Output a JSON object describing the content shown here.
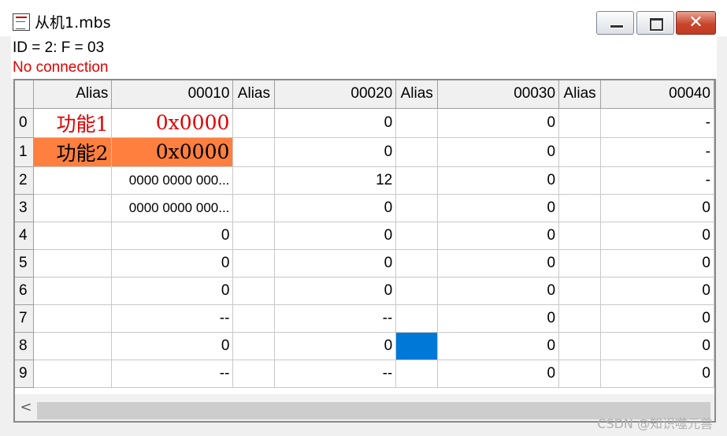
{
  "window": {
    "title": "从机1.mbs",
    "close_glyph": "✕"
  },
  "info": {
    "line1": "ID = 2: F = 03",
    "line2": "No connection"
  },
  "grid": {
    "headers": [
      "Alias",
      "00010",
      "Alias",
      "00020",
      "Alias",
      "00030",
      "Alias",
      "00040"
    ],
    "rows": [
      {
        "row": "0",
        "a1": "功能1",
        "c1": "0x0000",
        "a2": "",
        "c2": "0",
        "a3": "",
        "c3": "0",
        "a4": "",
        "c4": "-"
      },
      {
        "row": "1",
        "a1": "功能2",
        "c1": "0x0000",
        "a2": "",
        "c2": "0",
        "a3": "",
        "c3": "0",
        "a4": "",
        "c4": "-"
      },
      {
        "row": "2",
        "a1": "",
        "c1": "0000 0000 000...",
        "a2": "",
        "c2": "12",
        "a3": "",
        "c3": "0",
        "a4": "",
        "c4": "-"
      },
      {
        "row": "3",
        "a1": "",
        "c1": "0000 0000 000...",
        "a2": "",
        "c2": "0",
        "a3": "",
        "c3": "0",
        "a4": "",
        "c4": "0"
      },
      {
        "row": "4",
        "a1": "",
        "c1": "0",
        "a2": "",
        "c2": "0",
        "a3": "",
        "c3": "0",
        "a4": "",
        "c4": "0"
      },
      {
        "row": "5",
        "a1": "",
        "c1": "0",
        "a2": "",
        "c2": "0",
        "a3": "",
        "c3": "0",
        "a4": "",
        "c4": "0"
      },
      {
        "row": "6",
        "a1": "",
        "c1": "0",
        "a2": "",
        "c2": "0",
        "a3": "",
        "c3": "0",
        "a4": "",
        "c4": "0"
      },
      {
        "row": "7",
        "a1": "",
        "c1": "--",
        "a2": "",
        "c2": "--",
        "a3": "",
        "c3": "0",
        "a4": "",
        "c4": "0"
      },
      {
        "row": "8",
        "a1": "",
        "c1": "0",
        "a2": "",
        "c2": "0",
        "a3": "",
        "c3": "0",
        "a4": "",
        "c4": "0"
      },
      {
        "row": "9",
        "a1": "",
        "c1": "--",
        "a2": "",
        "c2": "--",
        "a3": "",
        "c3": "0",
        "a4": "",
        "c4": "0"
      }
    ]
  },
  "scrollbar": {
    "left_arrow": "<"
  },
  "watermark": "CSDN @知识噬元兽",
  "colors": {
    "alias_text": "#e00000",
    "highlight_row": "#ff7f3f",
    "selected_cell": "#0078d7"
  }
}
